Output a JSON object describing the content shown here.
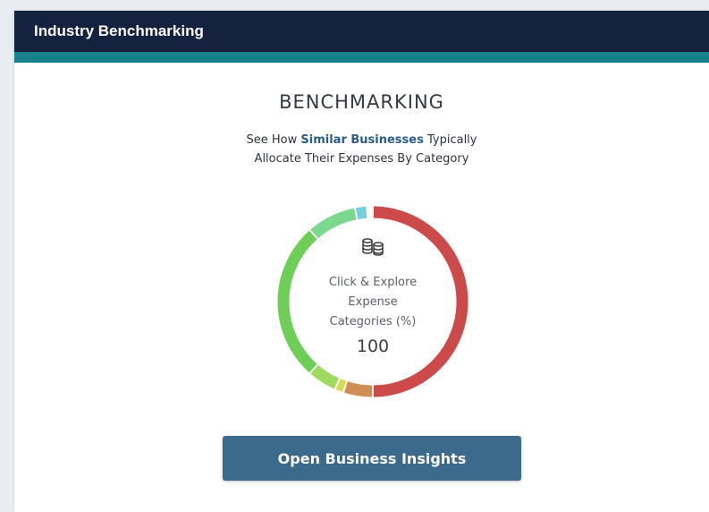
{
  "panel": {
    "title": "Industry Benchmarking"
  },
  "main": {
    "heading": "BENCHMARKING",
    "subtitle_prefix": "See How ",
    "subtitle_highlight": "Similar Businesses",
    "subtitle_suffix": " Typically",
    "subtitle_line2": "Allocate Their Expenses By Category",
    "donut": {
      "icon": "coins-icon",
      "center_line1": "Click & Explore",
      "center_line2": "Expense",
      "center_line3": "Categories (%)",
      "center_value": "100",
      "segments": [
        {
          "color": "#cc4a4a",
          "share": 0.5
        },
        {
          "color": "#d18e54",
          "share": 0.05
        },
        {
          "color": "#d8dc5a",
          "share": 0.015
        },
        {
          "color": "#9fda5e",
          "share": 0.05
        },
        {
          "color": "#6fce58",
          "share": 0.27
        },
        {
          "color": "#7cd88f",
          "share": 0.085
        },
        {
          "color": "#74cfe0",
          "share": 0.02
        }
      ]
    },
    "button_label": "Open Business Insights"
  },
  "colors": {
    "header_bg": "#14213f",
    "accent": "#187f8c",
    "highlight_text": "#2b5c8a",
    "button_bg": "#3b6a8d"
  }
}
